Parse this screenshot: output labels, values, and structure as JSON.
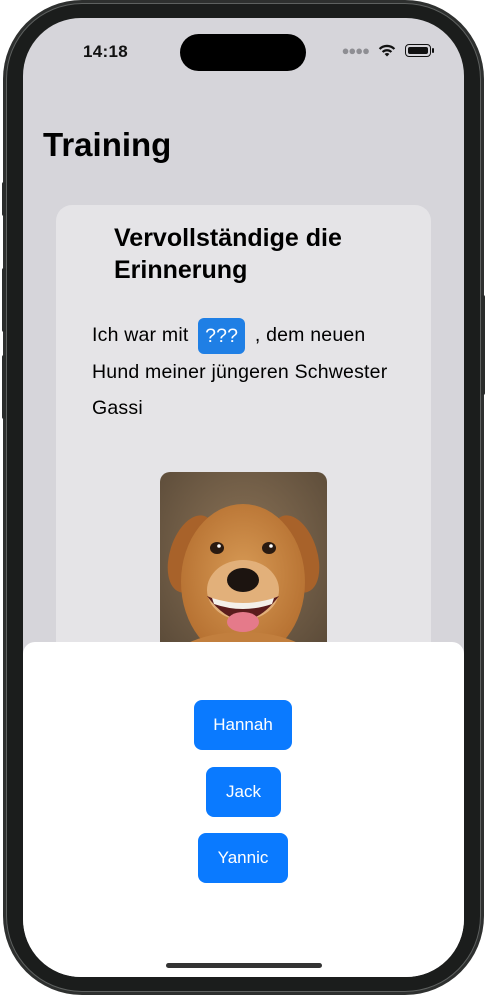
{
  "status_bar": {
    "time": "14:18",
    "signal_icon": "cellular-signal-icon",
    "wifi_icon": "wifi-icon",
    "battery_icon": "battery-icon"
  },
  "page": {
    "title": "Training"
  },
  "card": {
    "title": "Vervollständige die Erinnerung",
    "sentence_before": "Ich war mit",
    "blank": "???",
    "sentence_after": ", dem neuen Hund meiner jüngeren Schwester Gassi",
    "photo_icon": "dog-photo"
  },
  "answers": {
    "option_1": "Hannah",
    "option_2": "Jack",
    "option_3": "Yannic"
  },
  "colors": {
    "accent": "#0a7aff",
    "background": "#d6d5da",
    "card": "#e5e4e7",
    "sheet": "#ffffff"
  }
}
